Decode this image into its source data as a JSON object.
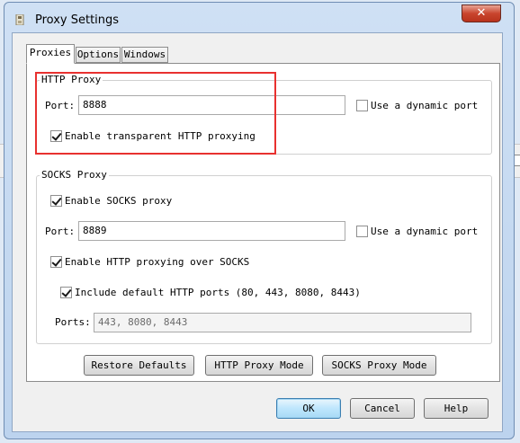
{
  "window": {
    "title": "Proxy Settings",
    "close_symbol": "✕"
  },
  "tabs": [
    {
      "label": "Proxies",
      "active": true
    },
    {
      "label": "Options",
      "active": false
    },
    {
      "label": "Windows",
      "active": false
    }
  ],
  "http_proxy": {
    "legend": "HTTP Proxy",
    "port_label": "Port:",
    "port_value": "8888",
    "dynamic_port_label": "Use a dynamic port",
    "dynamic_port_checked": false,
    "transparent_label": "Enable transparent HTTP proxying",
    "transparent_checked": true
  },
  "socks_proxy": {
    "legend": "SOCKS Proxy",
    "enable_label": "Enable SOCKS proxy",
    "enable_checked": true,
    "port_label": "Port:",
    "port_value": "8889",
    "dynamic_port_label": "Use a dynamic port",
    "dynamic_port_checked": false,
    "http_over_socks_label": "Enable HTTP proxying over SOCKS",
    "http_over_socks_checked": true,
    "include_default_ports_label": "Include default HTTP ports (80, 443, 8080, 8443)",
    "include_default_ports_checked": true,
    "ports_label": "Ports:",
    "ports_value": "443, 8080, 8443"
  },
  "actions": {
    "restore_defaults": "Restore Defaults",
    "http_proxy_mode": "HTTP Proxy Mode",
    "socks_proxy_mode": "SOCKS Proxy Mode"
  },
  "dialog_buttons": {
    "ok": "OK",
    "cancel": "Cancel",
    "help": "Help"
  },
  "colors": {
    "highlight": "#e8312f",
    "window_frame": "#bcd3ee",
    "default_button": "#bee6fd"
  }
}
